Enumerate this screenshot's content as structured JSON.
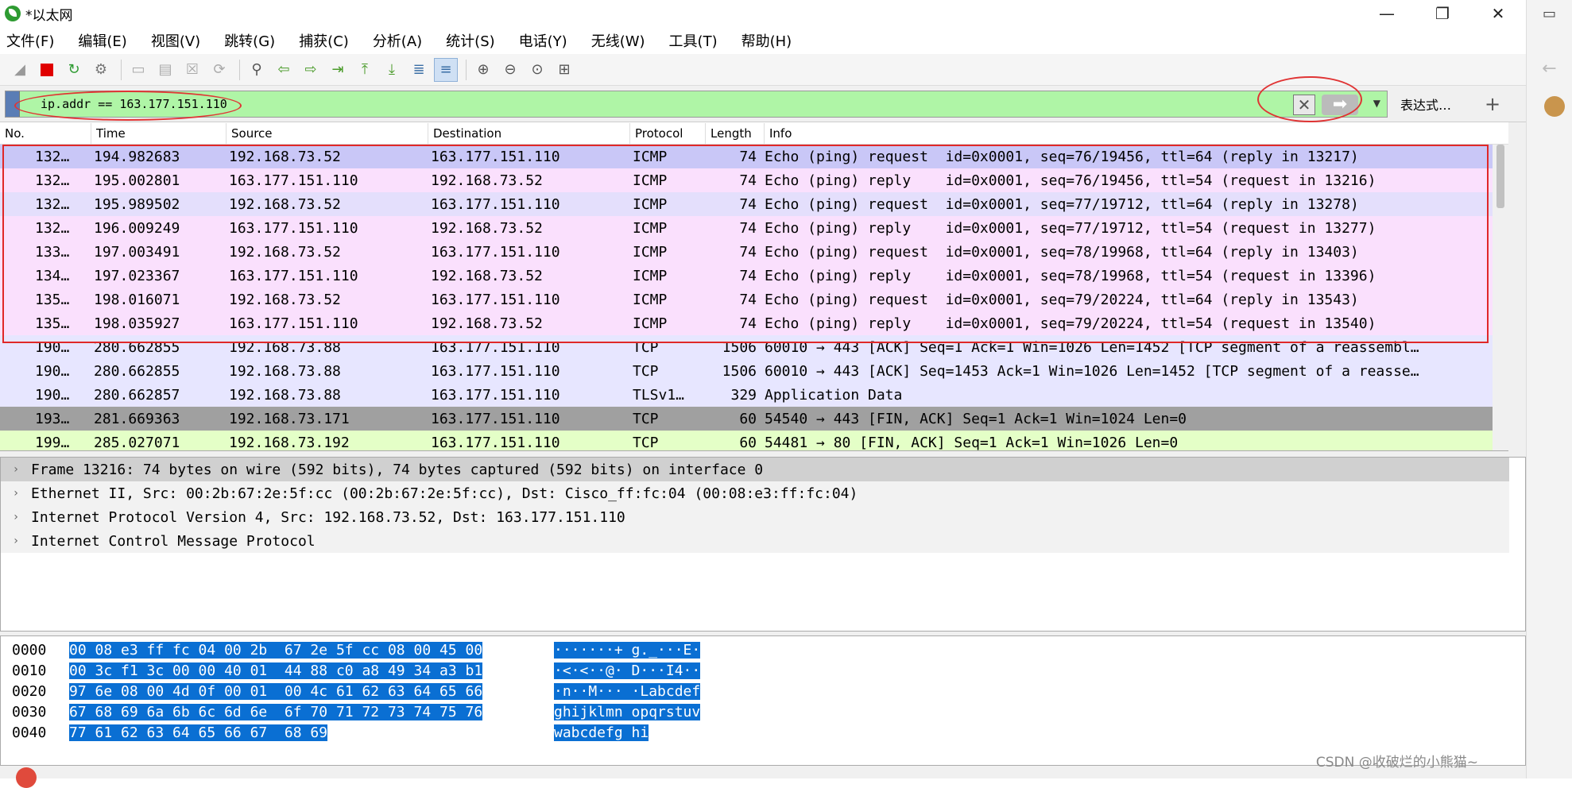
{
  "window": {
    "title": "*以太网",
    "controls": [
      "—",
      "❐",
      "✕"
    ]
  },
  "menu": [
    "文件(F)",
    "编辑(E)",
    "视图(V)",
    "跳转(G)",
    "捕获(C)",
    "分析(A)",
    "统计(S)",
    "电话(Y)",
    "无线(W)",
    "工具(T)",
    "帮助(H)"
  ],
  "filter": {
    "value": "ip.addr == 163.177.151.110",
    "expression_label": "表达式…",
    "add_label": "+"
  },
  "columns": [
    "No.",
    "Time",
    "Source",
    "Destination",
    "Protocol",
    "Length",
    "Info"
  ],
  "packets": [
    {
      "no": "132…",
      "time": "194.982683",
      "src": "192.168.73.52",
      "dst": "163.177.151.110",
      "proto": "ICMP",
      "len": "74",
      "info": "Echo (ping) request  id=0x0001, seq=76/19456, ttl=64 (reply in 13217)"
    },
    {
      "no": "132…",
      "time": "195.002801",
      "src": "163.177.151.110",
      "dst": "192.168.73.52",
      "proto": "ICMP",
      "len": "74",
      "info": "Echo (ping) reply    id=0x0001, seq=76/19456, ttl=54 (request in 13216)"
    },
    {
      "no": "132…",
      "time": "195.989502",
      "src": "192.168.73.52",
      "dst": "163.177.151.110",
      "proto": "ICMP",
      "len": "74",
      "info": "Echo (ping) request  id=0x0001, seq=77/19712, ttl=64 (reply in 13278)"
    },
    {
      "no": "132…",
      "time": "196.009249",
      "src": "163.177.151.110",
      "dst": "192.168.73.52",
      "proto": "ICMP",
      "len": "74",
      "info": "Echo (ping) reply    id=0x0001, seq=77/19712, ttl=54 (request in 13277)"
    },
    {
      "no": "133…",
      "time": "197.003491",
      "src": "192.168.73.52",
      "dst": "163.177.151.110",
      "proto": "ICMP",
      "len": "74",
      "info": "Echo (ping) request  id=0x0001, seq=78/19968, ttl=64 (reply in 13403)"
    },
    {
      "no": "134…",
      "time": "197.023367",
      "src": "163.177.151.110",
      "dst": "192.168.73.52",
      "proto": "ICMP",
      "len": "74",
      "info": "Echo (ping) reply    id=0x0001, seq=78/19968, ttl=54 (request in 13396)"
    },
    {
      "no": "135…",
      "time": "198.016071",
      "src": "192.168.73.52",
      "dst": "163.177.151.110",
      "proto": "ICMP",
      "len": "74",
      "info": "Echo (ping) request  id=0x0001, seq=79/20224, ttl=64 (reply in 13543)"
    },
    {
      "no": "135…",
      "time": "198.035927",
      "src": "163.177.151.110",
      "dst": "192.168.73.52",
      "proto": "ICMP",
      "len": "74",
      "info": "Echo (ping) reply    id=0x0001, seq=79/20224, ttl=54 (request in 13540)"
    },
    {
      "no": "190…",
      "time": "280.662855",
      "src": "192.168.73.88",
      "dst": "163.177.151.110",
      "proto": "TCP",
      "len": "1506",
      "info": "60010 → 443 [ACK] Seq=1 Ack=1 Win=1026 Len=1452 [TCP segment of a reassembl…"
    },
    {
      "no": "190…",
      "time": "280.662855",
      "src": "192.168.73.88",
      "dst": "163.177.151.110",
      "proto": "TCP",
      "len": "1506",
      "info": "60010 → 443 [ACK] Seq=1453 Ack=1 Win=1026 Len=1452 [TCP segment of a reasse…"
    },
    {
      "no": "190…",
      "time": "280.662857",
      "src": "192.168.73.88",
      "dst": "163.177.151.110",
      "proto": "TLSv1…",
      "len": "329",
      "info": "Application Data"
    },
    {
      "no": "193…",
      "time": "281.669363",
      "src": "192.168.73.171",
      "dst": "163.177.151.110",
      "proto": "TCP",
      "len": "60",
      "info": "54540 → 443 [FIN, ACK] Seq=1 Ack=1 Win=1024 Len=0"
    },
    {
      "no": "199…",
      "time": "285.027071",
      "src": "192.168.73.192",
      "dst": "163.177.151.110",
      "proto": "TCP",
      "len": "60",
      "info": "54481 → 80 [FIN, ACK] Seq=1 Ack=1 Win=1026 Len=0"
    }
  ],
  "row_styles": [
    "icmp-sel",
    "icmp",
    "icmp2",
    "icmp",
    "icmp",
    "icmp",
    "icmp",
    "icmp",
    "tcp",
    "tcp",
    "tcp",
    "fin",
    "http"
  ],
  "details": [
    "Frame 13216: 74 bytes on wire (592 bits), 74 bytes captured (592 bits) on interface 0",
    "Ethernet II, Src: 00:2b:67:2e:5f:cc (00:2b:67:2e:5f:cc), Dst: Cisco_ff:fc:04 (00:08:e3:ff:fc:04)",
    "Internet Protocol Version 4, Src: 192.168.73.52, Dst: 163.177.151.110",
    "Internet Control Message Protocol"
  ],
  "bytes": [
    {
      "offset": "0000",
      "hex": "00 08 e3 ff fc 04 00 2b  67 2e 5f cc 08 00 45 00",
      "ascii": "·······+ g._···E·"
    },
    {
      "offset": "0010",
      "hex": "00 3c f1 3c 00 00 40 01  44 88 c0 a8 49 34 a3 b1",
      "ascii": "·<·<··@· D···I4··"
    },
    {
      "offset": "0020",
      "hex": "97 6e 08 00 4d 0f 00 01  00 4c 61 62 63 64 65 66",
      "ascii": "·n··M··· ·Labcdef"
    },
    {
      "offset": "0030",
      "hex": "67 68 69 6a 6b 6c 6d 6e  6f 70 71 72 73 74 75 76",
      "ascii": "ghijklmn opqrstuv"
    },
    {
      "offset": "0040",
      "hex": "77 61 62 63 64 65 66 67  68 69",
      "ascii": "wabcdefg hi"
    }
  ],
  "watermark": "CSDN @收破烂的小熊猫~",
  "colors": {
    "selected_row": "#c9c7f7",
    "icmp_row": "#fae0fd",
    "tcp_row": "#e7e6ff",
    "filter_bg": "#aff5a6",
    "highlight": "#0a6fd3",
    "annotation": "#e02828"
  }
}
